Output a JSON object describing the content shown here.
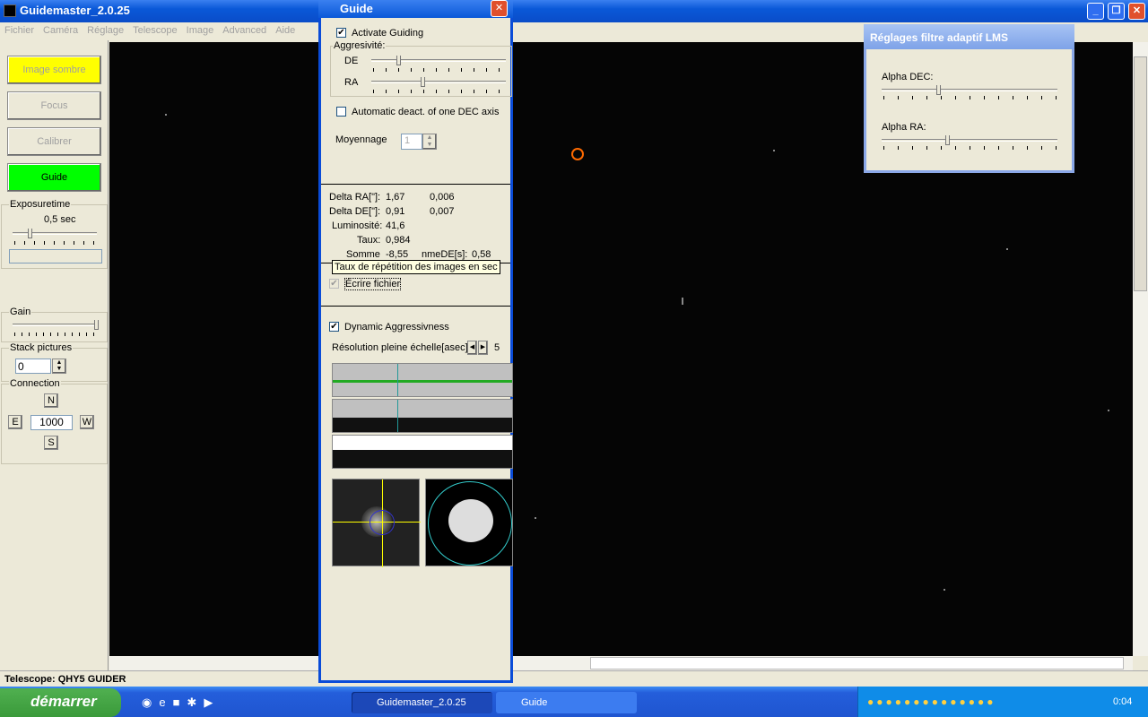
{
  "app": {
    "title": "Guidemaster_2.0.25"
  },
  "menu": [
    "Fichier",
    "Caméra",
    "Réglage",
    "Telescope",
    "Image",
    "Advanced",
    "Aide"
  ],
  "left": {
    "buttons": {
      "dark": "Image sombre",
      "focus": "Focus",
      "calibrate": "Calibrer",
      "guide": "Guide"
    },
    "colors": {
      "dark": "#ffff00",
      "guide": "#00ff00"
    },
    "exposure": {
      "label": "Exposuretime",
      "value": "0,5 sec"
    },
    "gain": {
      "label": "Gain"
    },
    "stack": {
      "label": "Stack pictures",
      "value": "0"
    },
    "connection": {
      "label": "Connection",
      "n": "N",
      "e": "E",
      "w": "W",
      "s": "S",
      "value": "1000"
    }
  },
  "status": {
    "text": "Telescope: QHY5 GUIDER"
  },
  "guide": {
    "title": "Guide",
    "activate": "Activate Guiding",
    "aggr": "Aggresivité:",
    "de": "DE",
    "ra": "RA",
    "autodeact": "Automatic deact. of one DEC axis",
    "moyennage": "Moyennage",
    "moyennage_value": "1",
    "stats": {
      "dra_label": "Delta RA[\"]:",
      "dra": "1,67",
      "dra2": "0,006",
      "dde_label": "Delta DE[\"]:",
      "dde": "0,91",
      "dde2": "0,007",
      "lum_label": "Luminosité:",
      "lum": "41,6",
      "taux_label": "Taux:",
      "taux": "0,984",
      "somme_label": "Somme",
      "somme": "-8,55",
      "sommede_label": "nmeDE[s]:",
      "sommede": "0,58"
    },
    "tooltip": "Taux de répétition des images en sec",
    "ecrire": "Écrire fichier",
    "dynamic": "Dynamic Aggressivness",
    "resolution": "Résolution pleine échelle[asec]:",
    "resolution_value": "5"
  },
  "lms": {
    "title": "Réglages filtre adaptif LMS",
    "alpha_dec": "Alpha DEC:",
    "alpha_ra": "Alpha RA:"
  },
  "taskbar": {
    "start": "démarrer",
    "tasks": [
      "Guidemaster_2.0.25",
      "Guide"
    ],
    "clock": "0:04"
  }
}
